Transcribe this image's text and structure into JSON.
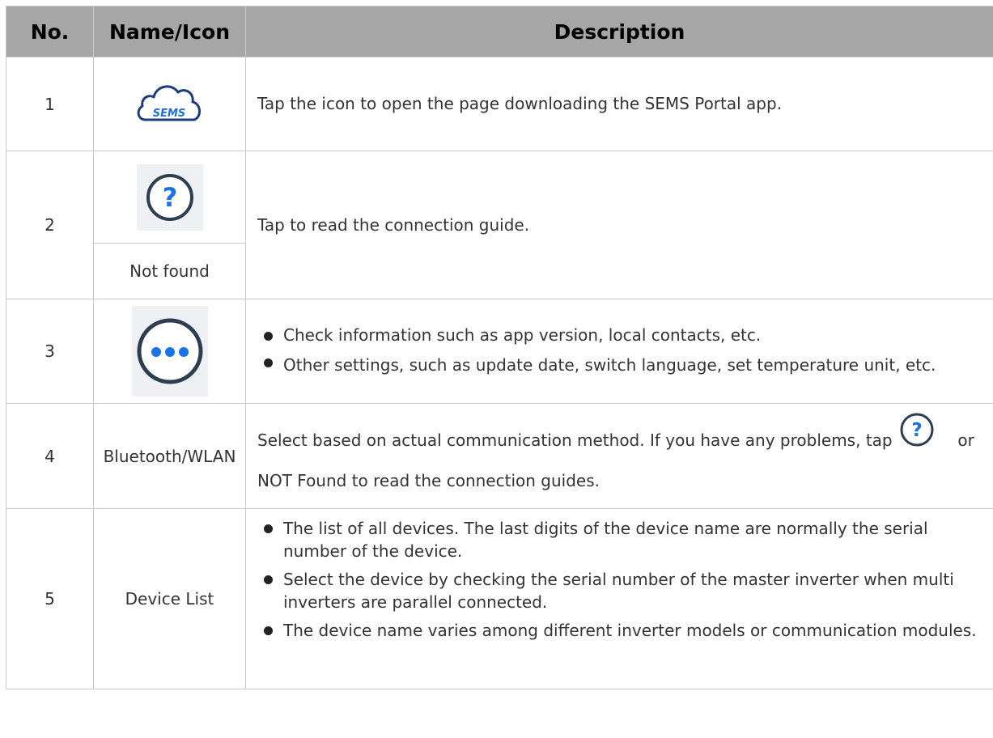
{
  "headers": {
    "no": "No.",
    "name_icon": "Name/Icon",
    "description": "Description"
  },
  "rows": [
    {
      "no": "1",
      "icon": "sems-cloud-icon",
      "icon_text": "SEMS",
      "description": "Tap the icon to open the page downloading the SEMS Portal app."
    },
    {
      "no": "2",
      "icon": "question-icon",
      "name": "Not found",
      "description": "Tap to read the connection guide."
    },
    {
      "no": "3",
      "icon": "more-options-icon",
      "bullets": [
        "Check information such as app version, local contacts, etc.",
        "Other settings, such as update date, switch language, set temperature unit, etc."
      ]
    },
    {
      "no": "4",
      "name": "Bluetooth/WLAN",
      "description_part1": "Select based on actual communication method. If you have any problems, tap",
      "description_part2": "or NOT Found to read the connection guides."
    },
    {
      "no": "5",
      "name": "Device List",
      "bullets": [
        "The list of all devices. The last digits of the device name are normally the serial number of the device.",
        "Select the device by checking the serial number of the master inverter when multi inverters are parallel connected.",
        "The device name varies among different inverter models or communication modules."
      ]
    }
  ],
  "colors": {
    "header_bg": "#a6a6a6",
    "border": "#c9c9c9",
    "icon_blue": "#1a73e8",
    "icon_dark": "#2d3e50"
  }
}
